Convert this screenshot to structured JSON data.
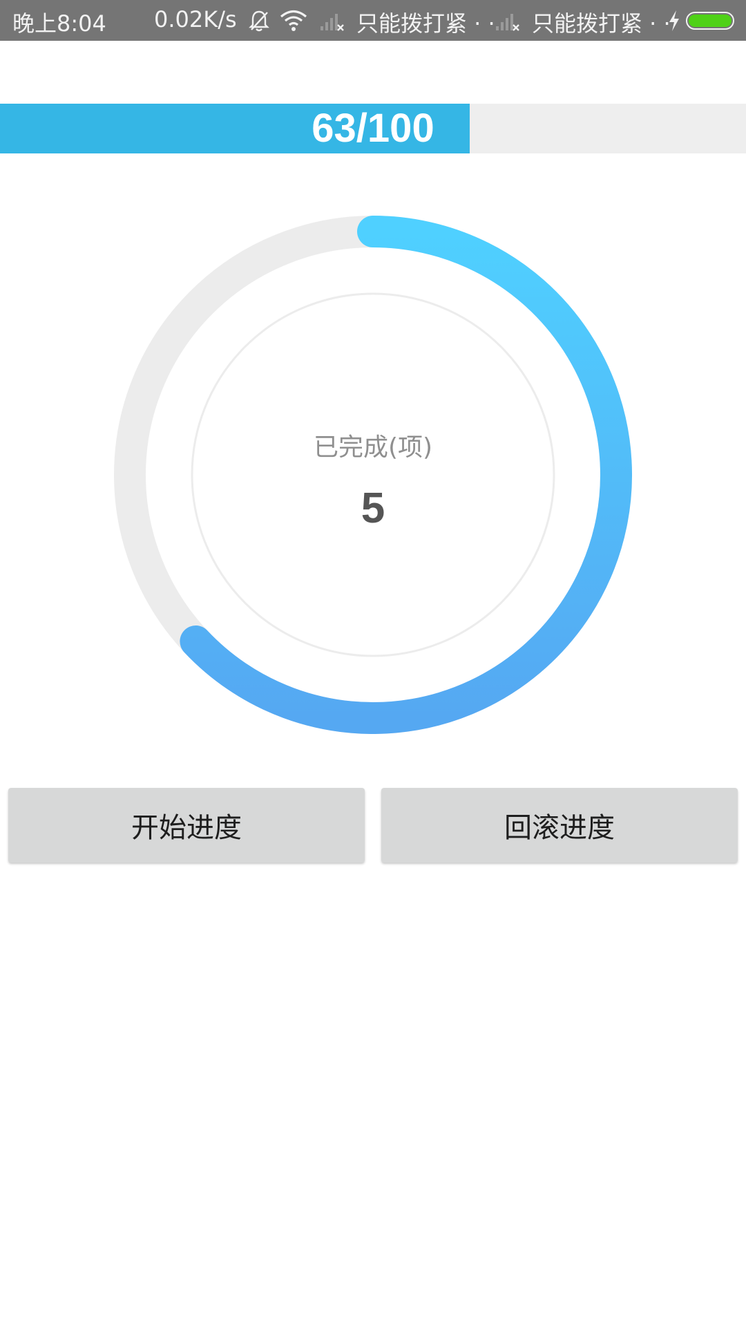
{
  "status_bar": {
    "time": "晚上8:04",
    "net_speed": "0.02K/s",
    "carrier_1": "只能拨打紧 · ·",
    "carrier_2": "只能拨打紧 · ·",
    "icons": [
      "bell-off-icon",
      "wifi-icon",
      "signal-no-sim-icon",
      "signal-no-sim-icon",
      "charging-icon",
      "battery-icon"
    ],
    "battery_color": "#4fd117"
  },
  "linear_progress": {
    "text": "63/100",
    "value": 63,
    "max": 100,
    "fill_color": "#35b6e5",
    "track_color": "#eeeeee"
  },
  "circular_progress": {
    "label": "已完成(项)",
    "value": "5",
    "fraction": 0.63,
    "gradient_start": "#4fd0ff",
    "gradient_end": "#55a8f2",
    "track_color": "#ececec"
  },
  "buttons": {
    "start": "开始进度",
    "rollback": "回滚进度"
  }
}
